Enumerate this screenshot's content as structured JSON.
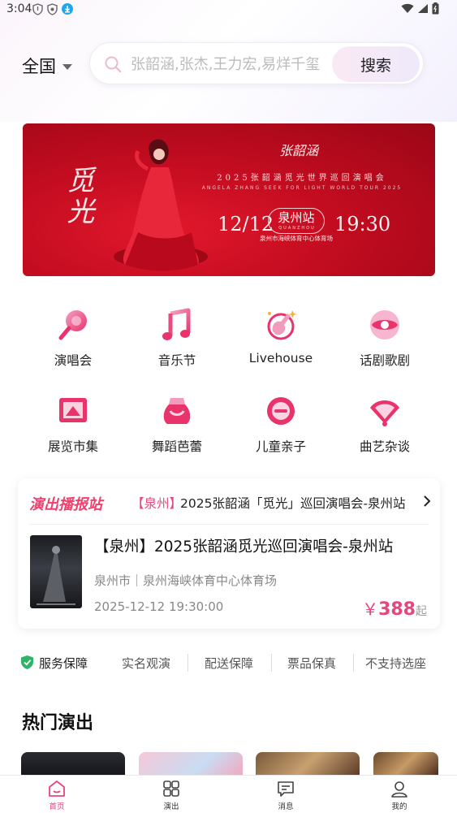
{
  "status_bar": {
    "time": "3:04"
  },
  "header": {
    "region": "全国",
    "search_placeholder": "张韶涵,张杰,王力宏,易烊千玺",
    "search_button": "搜索"
  },
  "banner": {
    "art_title": "觅光",
    "logo_text": "张韶涵",
    "tour_name_cn": "2025张韶涵觅光世界巡回演唱会",
    "tour_name_en": "ANGELA ZHANG SEEK FOR LIGHT WORLD TOUR 2025",
    "date": "12/12",
    "station": "泉州站",
    "station_en": "QUANZHOU",
    "time": "19:30",
    "venue": "泉州市海峡体育中心体育场"
  },
  "categories": [
    {
      "label": "演唱会",
      "icon": "microphone-icon"
    },
    {
      "label": "音乐节",
      "icon": "music-note-icon"
    },
    {
      "label": "Livehouse",
      "icon": "guitar-icon"
    },
    {
      "label": "话剧歌剧",
      "icon": "drama-icon"
    },
    {
      "label": "展览市集",
      "icon": "exhibition-icon"
    },
    {
      "label": "舞蹈芭蕾",
      "icon": "ballet-skirt-icon"
    },
    {
      "label": "儿童亲子",
      "icon": "child-icon"
    },
    {
      "label": "曲艺杂谈",
      "icon": "folding-fan-icon"
    }
  ],
  "broadcast": {
    "logo": "演出播报站",
    "city_tag": "【泉州】",
    "headline": "2025张韶涵「觅光」巡回演唱会-泉州站",
    "show": {
      "title": "【泉州】2025张韶涵觅光巡回演唱会-泉州站",
      "venue": "泉州市｜泉州海峡体育中心体育场",
      "datetime": "2025-12-12 19:30:00",
      "price_currency": "￥",
      "price": "388",
      "price_suffix": "起"
    }
  },
  "service": {
    "title": "服务保障",
    "items": [
      "实名观演",
      "配送保障",
      "票品保真",
      "不支持选座"
    ]
  },
  "hot": {
    "title": "热门演出"
  },
  "tabbar": [
    {
      "label": "首页",
      "icon": "home-icon",
      "active": true
    },
    {
      "label": "演出",
      "icon": "grid-icon",
      "active": false
    },
    {
      "label": "消息",
      "icon": "message-icon",
      "active": false
    },
    {
      "label": "我的",
      "icon": "profile-icon",
      "active": false
    }
  ],
  "colors": {
    "accent": "#e8457a",
    "banner_red": "#c30c20"
  }
}
